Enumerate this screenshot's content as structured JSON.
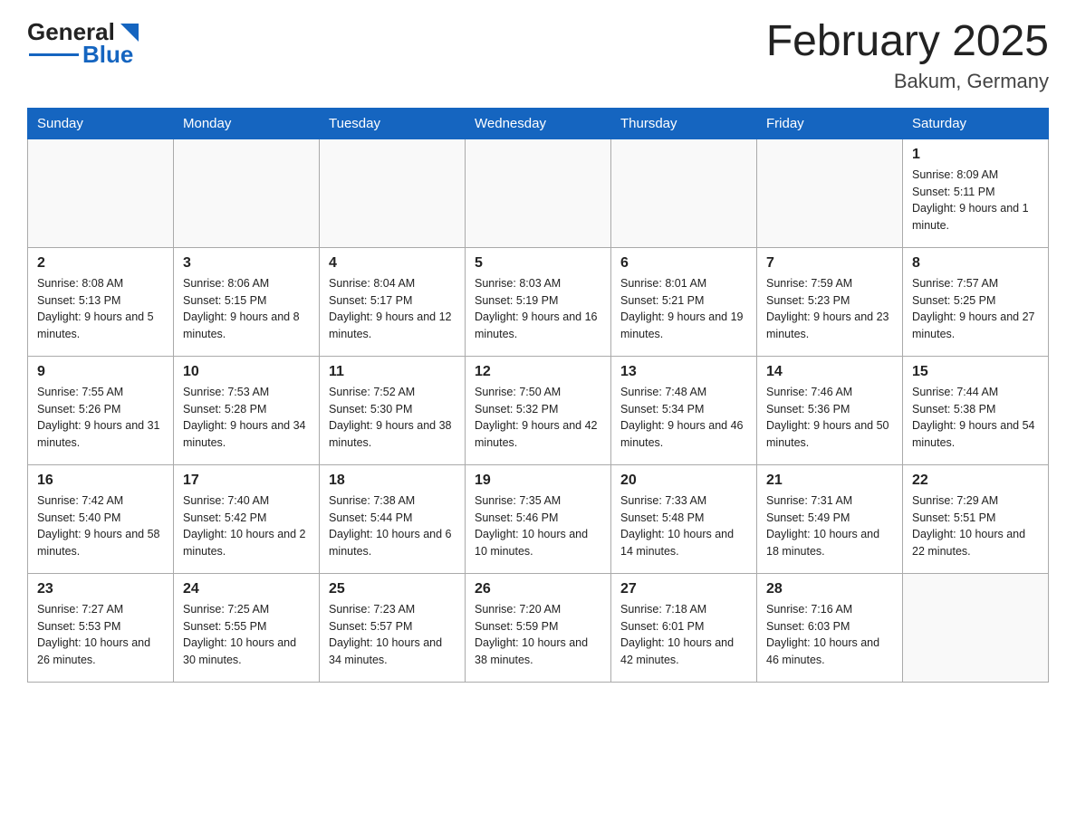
{
  "header": {
    "logo_general": "General",
    "logo_blue": "Blue",
    "title": "February 2025",
    "subtitle": "Bakum, Germany"
  },
  "days_of_week": [
    "Sunday",
    "Monday",
    "Tuesday",
    "Wednesday",
    "Thursday",
    "Friday",
    "Saturday"
  ],
  "weeks": [
    [
      {
        "day": "",
        "info": ""
      },
      {
        "day": "",
        "info": ""
      },
      {
        "day": "",
        "info": ""
      },
      {
        "day": "",
        "info": ""
      },
      {
        "day": "",
        "info": ""
      },
      {
        "day": "",
        "info": ""
      },
      {
        "day": "1",
        "info": "Sunrise: 8:09 AM\nSunset: 5:11 PM\nDaylight: 9 hours and 1 minute."
      }
    ],
    [
      {
        "day": "2",
        "info": "Sunrise: 8:08 AM\nSunset: 5:13 PM\nDaylight: 9 hours and 5 minutes."
      },
      {
        "day": "3",
        "info": "Sunrise: 8:06 AM\nSunset: 5:15 PM\nDaylight: 9 hours and 8 minutes."
      },
      {
        "day": "4",
        "info": "Sunrise: 8:04 AM\nSunset: 5:17 PM\nDaylight: 9 hours and 12 minutes."
      },
      {
        "day": "5",
        "info": "Sunrise: 8:03 AM\nSunset: 5:19 PM\nDaylight: 9 hours and 16 minutes."
      },
      {
        "day": "6",
        "info": "Sunrise: 8:01 AM\nSunset: 5:21 PM\nDaylight: 9 hours and 19 minutes."
      },
      {
        "day": "7",
        "info": "Sunrise: 7:59 AM\nSunset: 5:23 PM\nDaylight: 9 hours and 23 minutes."
      },
      {
        "day": "8",
        "info": "Sunrise: 7:57 AM\nSunset: 5:25 PM\nDaylight: 9 hours and 27 minutes."
      }
    ],
    [
      {
        "day": "9",
        "info": "Sunrise: 7:55 AM\nSunset: 5:26 PM\nDaylight: 9 hours and 31 minutes."
      },
      {
        "day": "10",
        "info": "Sunrise: 7:53 AM\nSunset: 5:28 PM\nDaylight: 9 hours and 34 minutes."
      },
      {
        "day": "11",
        "info": "Sunrise: 7:52 AM\nSunset: 5:30 PM\nDaylight: 9 hours and 38 minutes."
      },
      {
        "day": "12",
        "info": "Sunrise: 7:50 AM\nSunset: 5:32 PM\nDaylight: 9 hours and 42 minutes."
      },
      {
        "day": "13",
        "info": "Sunrise: 7:48 AM\nSunset: 5:34 PM\nDaylight: 9 hours and 46 minutes."
      },
      {
        "day": "14",
        "info": "Sunrise: 7:46 AM\nSunset: 5:36 PM\nDaylight: 9 hours and 50 minutes."
      },
      {
        "day": "15",
        "info": "Sunrise: 7:44 AM\nSunset: 5:38 PM\nDaylight: 9 hours and 54 minutes."
      }
    ],
    [
      {
        "day": "16",
        "info": "Sunrise: 7:42 AM\nSunset: 5:40 PM\nDaylight: 9 hours and 58 minutes."
      },
      {
        "day": "17",
        "info": "Sunrise: 7:40 AM\nSunset: 5:42 PM\nDaylight: 10 hours and 2 minutes."
      },
      {
        "day": "18",
        "info": "Sunrise: 7:38 AM\nSunset: 5:44 PM\nDaylight: 10 hours and 6 minutes."
      },
      {
        "day": "19",
        "info": "Sunrise: 7:35 AM\nSunset: 5:46 PM\nDaylight: 10 hours and 10 minutes."
      },
      {
        "day": "20",
        "info": "Sunrise: 7:33 AM\nSunset: 5:48 PM\nDaylight: 10 hours and 14 minutes."
      },
      {
        "day": "21",
        "info": "Sunrise: 7:31 AM\nSunset: 5:49 PM\nDaylight: 10 hours and 18 minutes."
      },
      {
        "day": "22",
        "info": "Sunrise: 7:29 AM\nSunset: 5:51 PM\nDaylight: 10 hours and 22 minutes."
      }
    ],
    [
      {
        "day": "23",
        "info": "Sunrise: 7:27 AM\nSunset: 5:53 PM\nDaylight: 10 hours and 26 minutes."
      },
      {
        "day": "24",
        "info": "Sunrise: 7:25 AM\nSunset: 5:55 PM\nDaylight: 10 hours and 30 minutes."
      },
      {
        "day": "25",
        "info": "Sunrise: 7:23 AM\nSunset: 5:57 PM\nDaylight: 10 hours and 34 minutes."
      },
      {
        "day": "26",
        "info": "Sunrise: 7:20 AM\nSunset: 5:59 PM\nDaylight: 10 hours and 38 minutes."
      },
      {
        "day": "27",
        "info": "Sunrise: 7:18 AM\nSunset: 6:01 PM\nDaylight: 10 hours and 42 minutes."
      },
      {
        "day": "28",
        "info": "Sunrise: 7:16 AM\nSunset: 6:03 PM\nDaylight: 10 hours and 46 minutes."
      },
      {
        "day": "",
        "info": ""
      }
    ]
  ]
}
